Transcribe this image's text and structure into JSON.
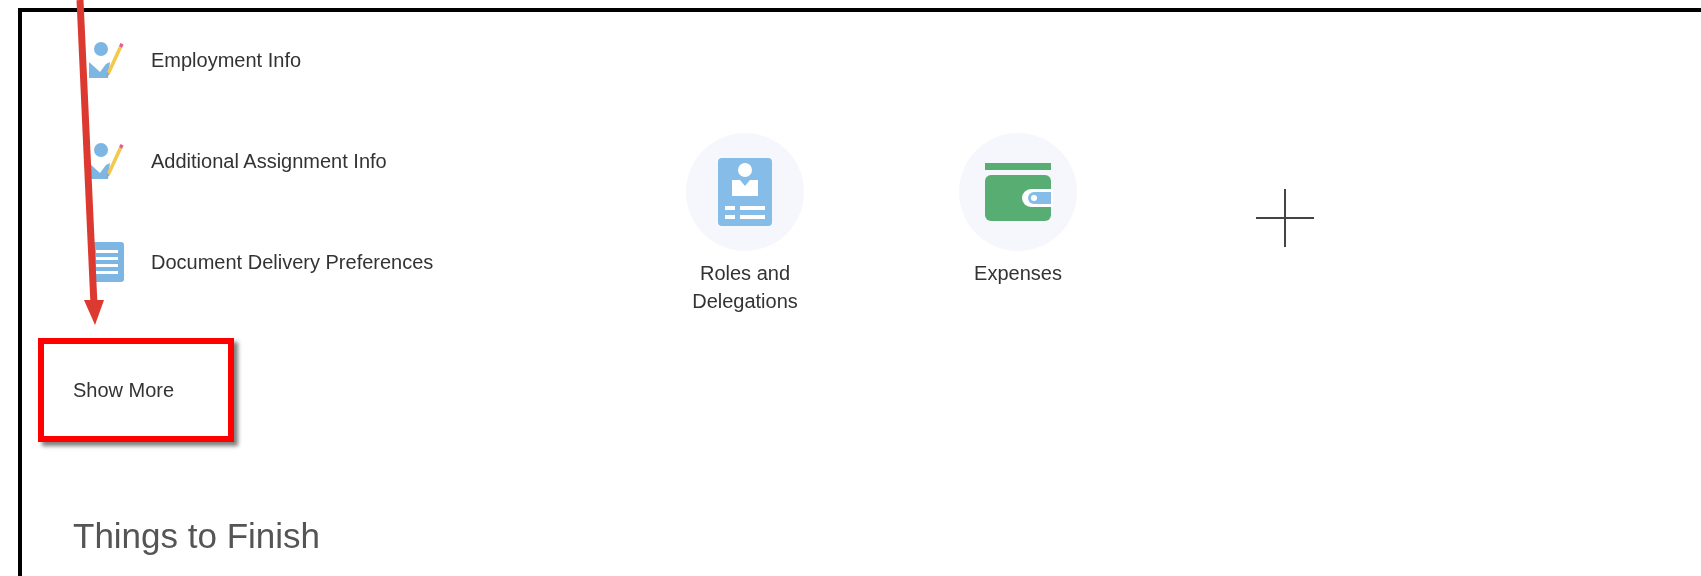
{
  "menu_items": [
    {
      "kind": "person-edit",
      "label": "Employment Info"
    },
    {
      "kind": "person-edit",
      "label": "Additional Assignment Info"
    },
    {
      "kind": "document",
      "label": "Document Delivery Preferences"
    }
  ],
  "show_more": {
    "label": "Show More",
    "highlighted": true
  },
  "tiles": [
    {
      "kind": "badge",
      "label": "Roles and Delegations"
    },
    {
      "kind": "wallet",
      "label": "Expenses"
    }
  ],
  "add_tile": true,
  "section_title": "Things to Finish"
}
